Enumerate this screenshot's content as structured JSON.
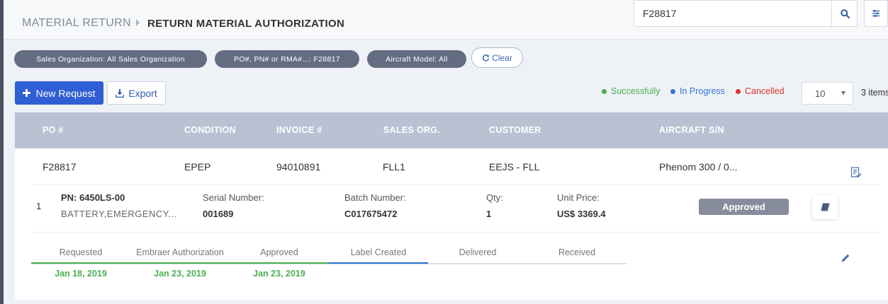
{
  "breadcrumb": {
    "parent": "MATERIAL RETURN",
    "current": "RETURN MATERIAL AUTHORIZATION"
  },
  "search": {
    "value": "F28817"
  },
  "filters": [
    "Sales Organization: All Sales Organization",
    "PO#, PN# or RMA#...: F28817",
    "Aircraft Model: All"
  ],
  "clear_label": "Clear",
  "toolbar": {
    "new_request": "New Request",
    "export": "Export"
  },
  "legend": [
    {
      "label": "Successfully",
      "color": "#4caf50"
    },
    {
      "label": "In Progress",
      "color": "#2f74d8"
    },
    {
      "label": "Cancelled",
      "color": "#d9352b"
    }
  ],
  "pagination": {
    "page_size": "10",
    "items": "3 items"
  },
  "table": {
    "columns": [
      "PO #",
      "CONDITION",
      "INVOICE #",
      "SALES ORG.",
      "CUSTOMER",
      "AIRCRAFT S/N"
    ],
    "row": {
      "po": "F28817",
      "condition": "EPEP",
      "invoice": "94010891",
      "sales_org": "FLL1",
      "customer": "EEJS - FLL",
      "aircraft": "Phenom 300 / 0..."
    },
    "item": {
      "index": "1",
      "pn": "PN: 6450LS-00",
      "description": "BATTERY,EMERGENCY...",
      "serial_label": "Serial Number:",
      "serial": "001689",
      "batch_label": "Batch Number:",
      "batch": "C017675472",
      "qty_label": "Qty:",
      "qty": "1",
      "price_label": "Unit Price:",
      "price": "US$ 3369.4",
      "status": "Approved"
    },
    "steps": [
      {
        "label": "Requested",
        "date": "Jan 18, 2019",
        "state": "done"
      },
      {
        "label": "Embraer Authorization",
        "date": "Jan 23, 2019",
        "state": "done"
      },
      {
        "label": "Approved",
        "date": "Jan 23, 2019",
        "state": "done"
      },
      {
        "label": "Label Created",
        "date": "",
        "state": "current"
      },
      {
        "label": "Delivered",
        "date": "",
        "state": "pending"
      },
      {
        "label": "Received",
        "date": "",
        "state": "pending"
      }
    ]
  },
  "colors": {
    "primary": "#2f5ed5",
    "header": "#b9c2d3",
    "done": "#4caf50",
    "current": "#2f74d8"
  }
}
